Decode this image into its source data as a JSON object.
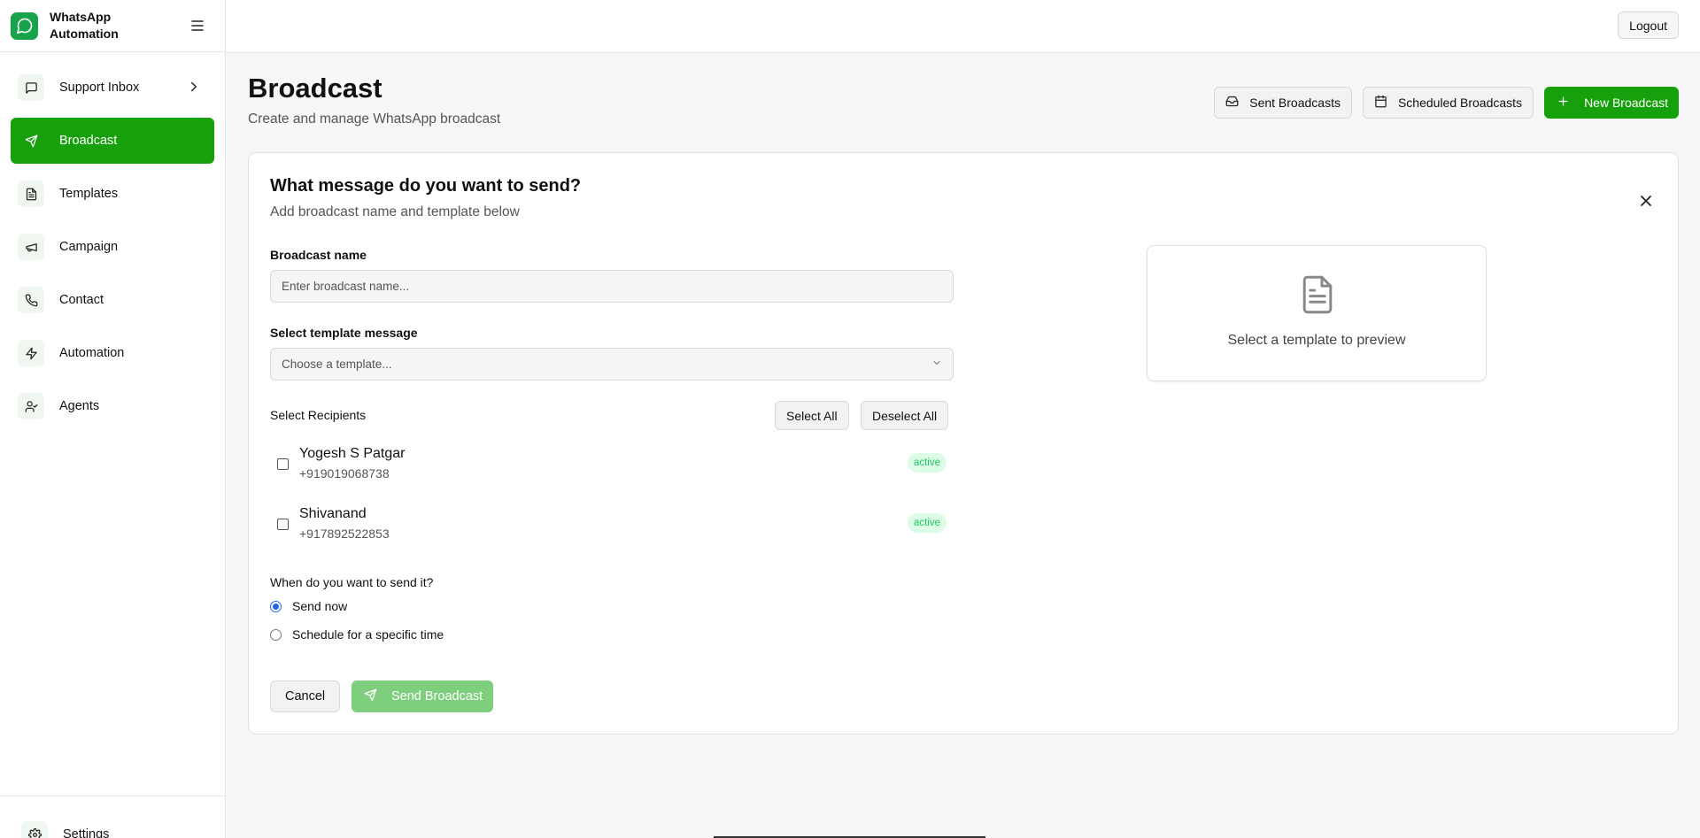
{
  "brand": {
    "name": "WhatsApp Automation",
    "line1": "WhatsApp",
    "line2": "Automation"
  },
  "sidebar": {
    "items": [
      {
        "label": "Support Inbox",
        "icon": "message-square-icon",
        "active": false,
        "has_chevron": true
      },
      {
        "label": "Broadcast",
        "icon": "send-icon",
        "active": true
      },
      {
        "label": "Templates",
        "icon": "file-text-icon",
        "active": false
      },
      {
        "label": "Campaign",
        "icon": "megaphone-icon",
        "active": false
      },
      {
        "label": "Contact",
        "icon": "phone-icon",
        "active": false
      },
      {
        "label": "Automation",
        "icon": "zap-icon",
        "active": false
      },
      {
        "label": "Agents",
        "icon": "user-check-icon",
        "active": false
      }
    ],
    "settings_label": "Settings"
  },
  "topbar": {
    "logout_label": "Logout"
  },
  "header": {
    "title": "Broadcast",
    "subtitle": "Create and manage WhatsApp broadcast",
    "sent_label": "Sent Broadcasts",
    "scheduled_label": "Scheduled Broadcasts",
    "new_label": "New Broadcast"
  },
  "form": {
    "title": "What message do you want to send?",
    "subtitle": "Add broadcast name and template below",
    "name_label": "Broadcast name",
    "name_placeholder": "Enter broadcast name...",
    "name_value": "",
    "template_label": "Select template message",
    "template_placeholder": "Choose a template...",
    "recipients_label": "Select Recipients",
    "select_all_label": "Select All",
    "deselect_all_label": "Deselect All",
    "recipients": [
      {
        "name": "Yogesh S Patgar",
        "phone": "+919019068738",
        "status": "active",
        "checked": false
      },
      {
        "name": "Shivanand",
        "phone": "+917892522853",
        "status": "active",
        "checked": false
      }
    ],
    "when_label": "When do you want to send it?",
    "send_now_label": "Send now",
    "schedule_label": "Schedule for a specific time",
    "selected_option": "Send now",
    "cancel_label": "Cancel",
    "send_label": "Send Broadcast"
  },
  "preview": {
    "text": "Select a template to preview"
  },
  "colors": {
    "brand_green": "#16a00b",
    "disabled_green": "#7dce7d",
    "badge_bg": "#dcfce7",
    "badge_text": "#22c55e",
    "radio_blue": "#2563eb"
  }
}
